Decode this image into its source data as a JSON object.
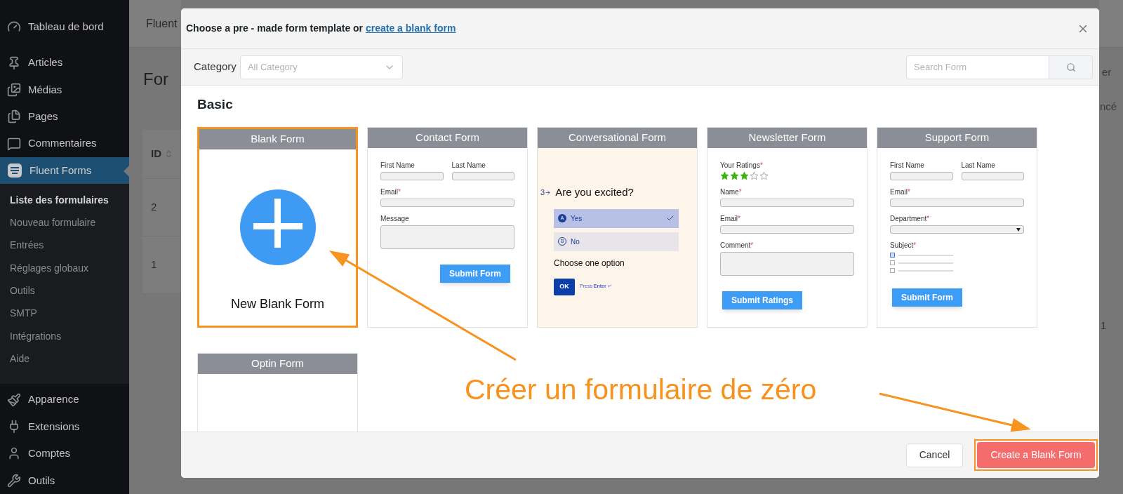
{
  "sidebar": {
    "items": [
      {
        "label": "Tableau de bord",
        "selected": false
      },
      {
        "label": "Articles",
        "selected": false
      },
      {
        "label": "Médias",
        "selected": false
      },
      {
        "label": "Pages",
        "selected": false
      },
      {
        "label": "Commentaires",
        "selected": false
      },
      {
        "label": "Fluent Forms",
        "selected": true,
        "children": [
          {
            "label": "Liste des formulaires",
            "selected": true
          },
          {
            "label": "Nouveau formulaire",
            "selected": false
          },
          {
            "label": "Entrées",
            "selected": false
          },
          {
            "label": "Réglages globaux",
            "selected": false
          },
          {
            "label": "Outils",
            "selected": false
          },
          {
            "label": "SMTP",
            "selected": false
          },
          {
            "label": "Intégrations",
            "selected": false
          },
          {
            "label": "Aide",
            "selected": false
          }
        ]
      },
      {
        "label": "Apparence",
        "selected": false
      },
      {
        "label": "Extensions",
        "selected": false
      },
      {
        "label": "Comptes",
        "selected": false
      },
      {
        "label": "Outils",
        "selected": false
      }
    ]
  },
  "background": {
    "header": "Fluent",
    "heading": "For",
    "table": {
      "header": "ID",
      "rows": [
        "2",
        "1"
      ]
    },
    "right_texts": [
      "er",
      "ncé",
      "1"
    ]
  },
  "modal": {
    "title": "Choose a pre - made form template or",
    "title_link": "create a blank form",
    "category_label": "Category",
    "category_placeholder": "All Category",
    "search_placeholder": "Search Form",
    "section": "Basic",
    "templates": [
      {
        "title": "Blank Form",
        "kind": "blank",
        "highlighted": true,
        "label": "New Blank Form"
      },
      {
        "title": "Contact Form",
        "kind": "form",
        "highlighted": false,
        "fields": [
          {
            "kind": "pair",
            "labels": [
              "First Name",
              "Last Name"
            ]
          },
          {
            "kind": "input",
            "label": "Email",
            "mark": "*"
          },
          {
            "kind": "textarea",
            "label": "Message"
          },
          {
            "kind": "button_right",
            "label": "Submit Form"
          }
        ]
      },
      {
        "title": "Conversational Form",
        "kind": "conversational",
        "highlighted": false,
        "number": "3",
        "question": "Are you excited?",
        "options": [
          {
            "key": "A",
            "label": "Yes",
            "selected": true
          },
          {
            "key": "B",
            "label": "No",
            "selected": false
          }
        ],
        "hint": "Choose one option",
        "ok": "OK",
        "press": "Press **Enter** ↵"
      },
      {
        "title": "Newsletter Form",
        "kind": "form",
        "highlighted": false,
        "fields": [
          {
            "kind": "stars",
            "label": "Your Ratings",
            "mark": "*",
            "stars": 3
          },
          {
            "kind": "input",
            "label": "Name",
            "mark": "*"
          },
          {
            "kind": "input",
            "label": "Email",
            "mark": "*"
          },
          {
            "kind": "textarea",
            "label": "Comment",
            "mark": "*"
          },
          {
            "kind": "button",
            "label": "Submit Ratings"
          }
        ]
      },
      {
        "title": "Support Form",
        "kind": "form",
        "highlighted": false,
        "fields": [
          {
            "kind": "pair",
            "labels": [
              "First Name",
              "Last Name"
            ]
          },
          {
            "kind": "input",
            "label": "Email",
            "mark": "*"
          },
          {
            "kind": "select",
            "label": "Department",
            "mark": "*"
          },
          {
            "kind": "checks",
            "label": "Subject",
            "mark": "*",
            "options": [
              {
                "checked": true
              },
              {
                "checked": false
              },
              {
                "checked": false
              }
            ]
          },
          {
            "kind": "button",
            "label": "Submit Form"
          }
        ]
      },
      {
        "title": "Optin Form",
        "kind": "empty",
        "highlighted": false
      }
    ],
    "cancel": "Cancel",
    "create": "Create a Blank Form",
    "create_highlighted": true
  },
  "annotation": {
    "text": "Créer un formulaire de zéro"
  }
}
